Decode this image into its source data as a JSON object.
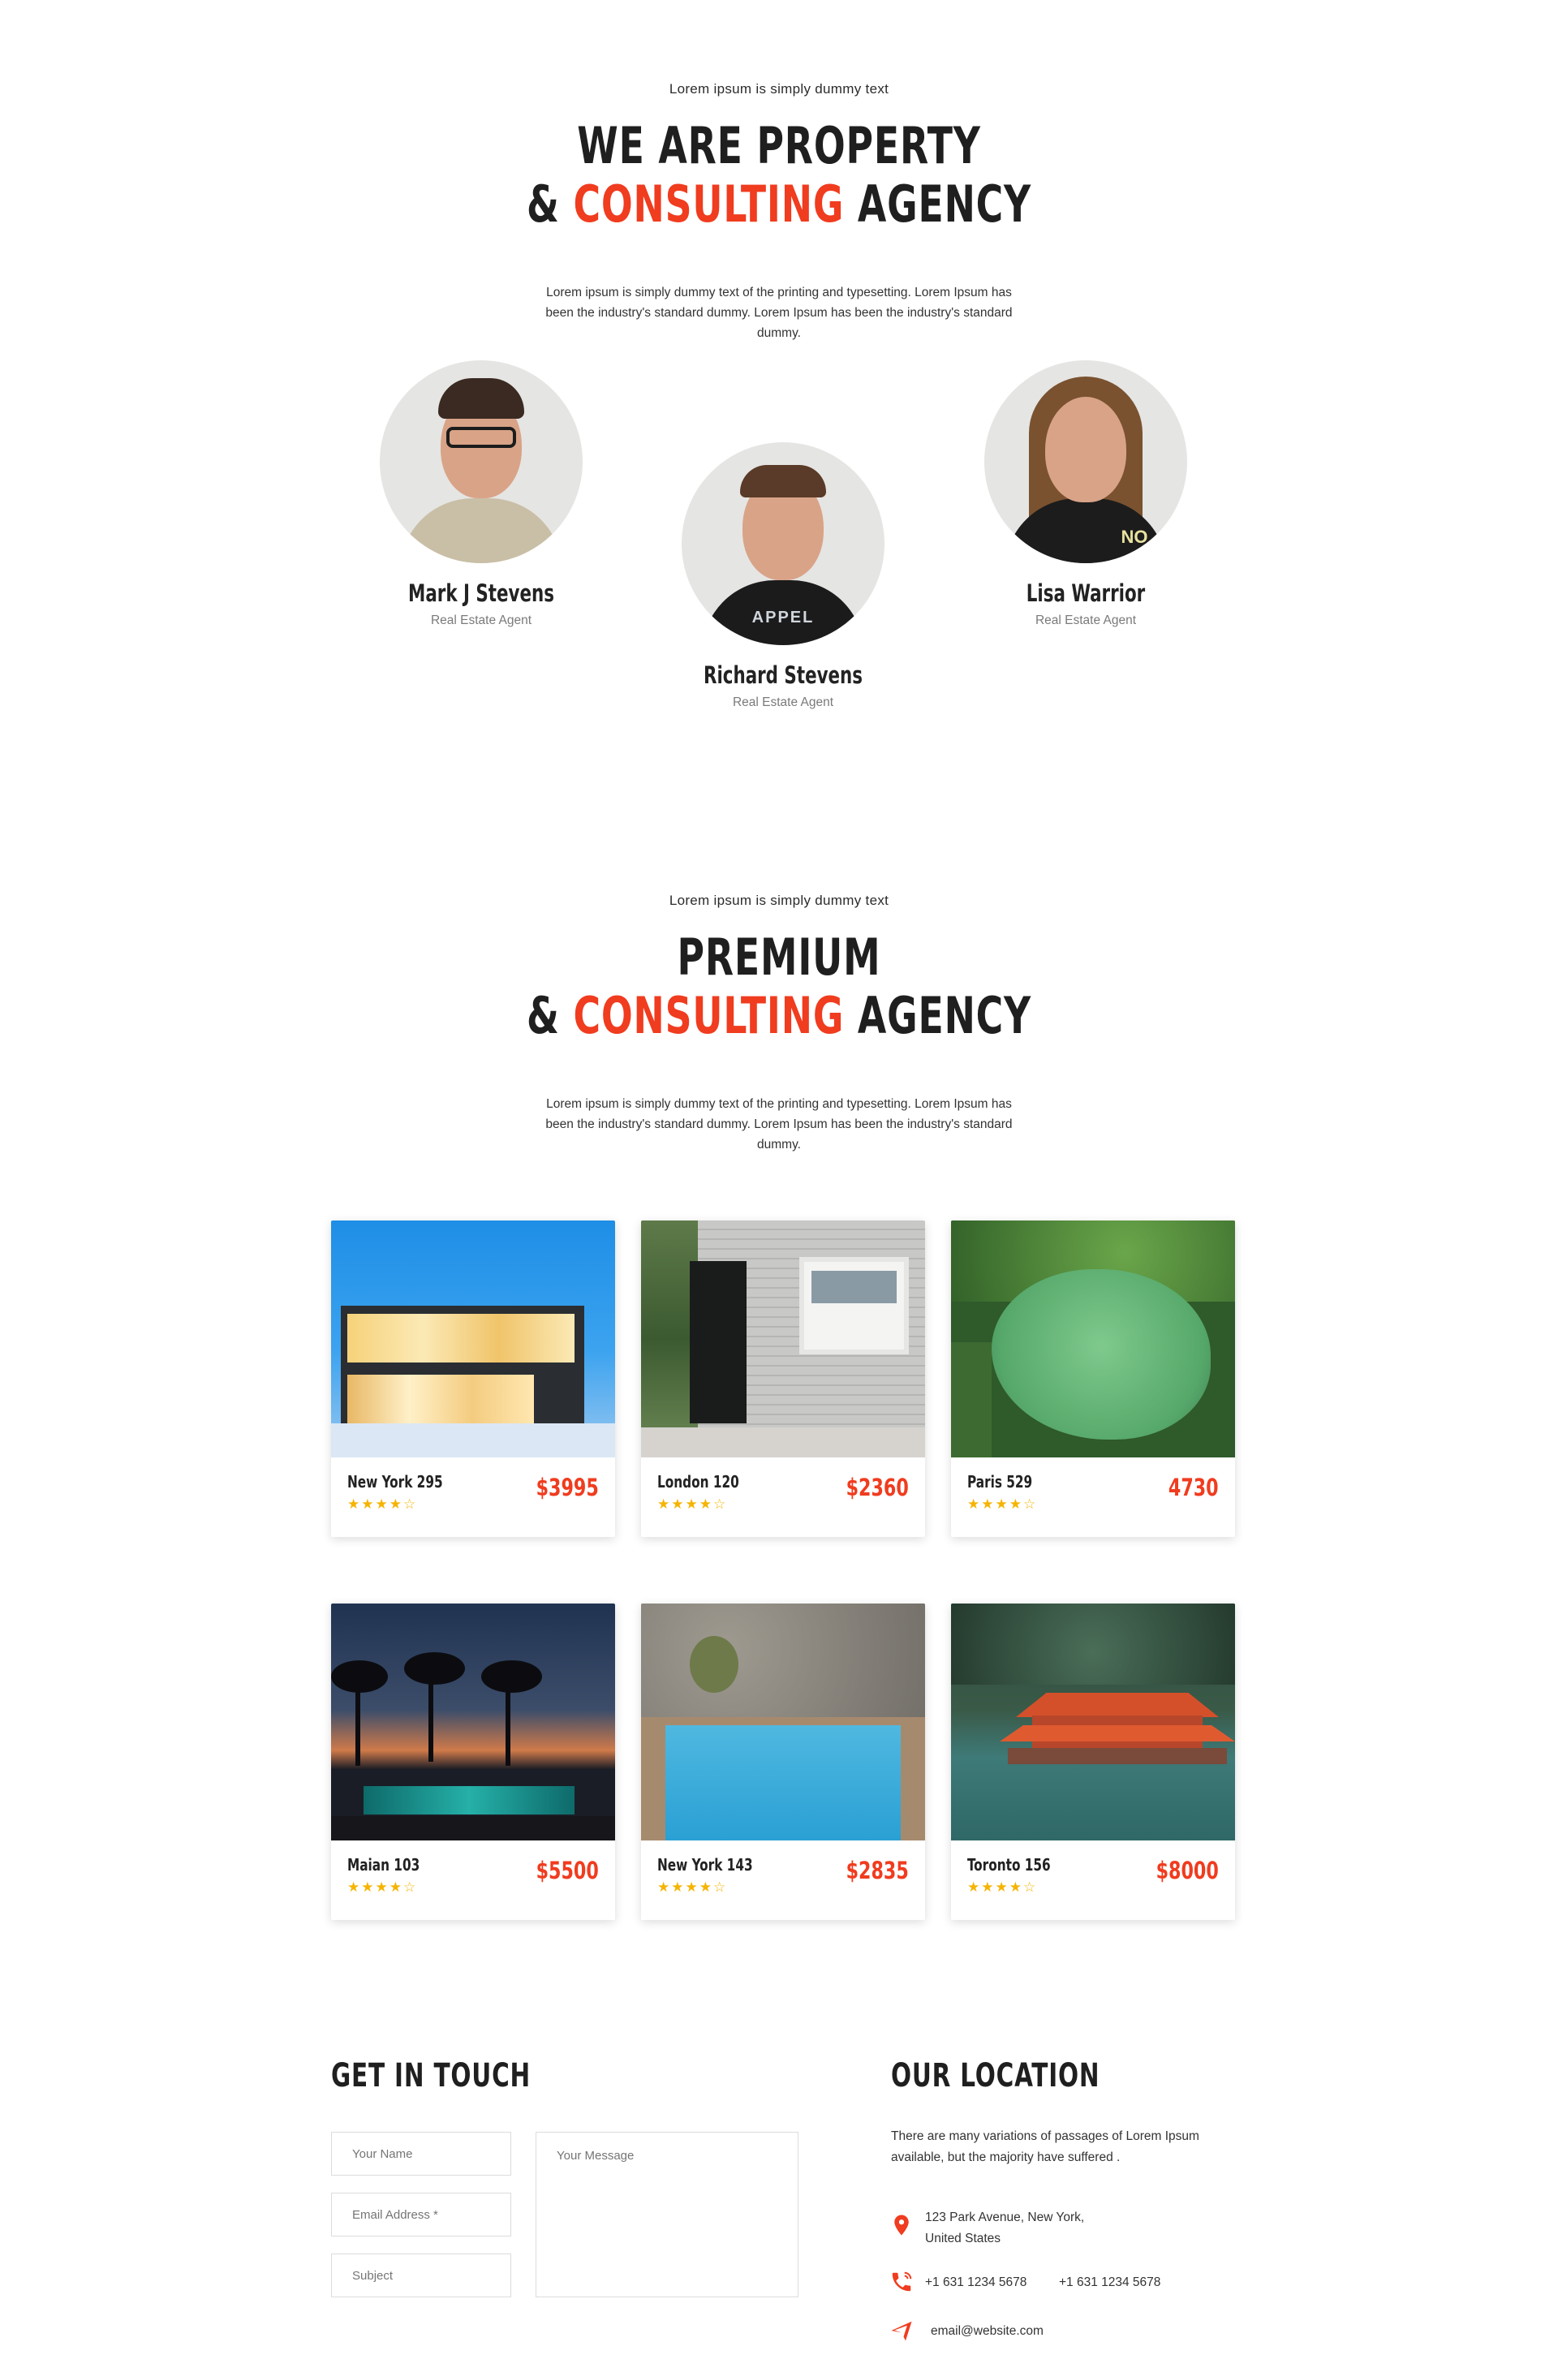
{
  "about": {
    "eyebrow": "Lorem ipsum is simply dummy text",
    "title_line1": "WE ARE PROPERTY",
    "title_amp": "&",
    "title_accent": "CONSULTING",
    "title_end": "AGENCY",
    "description": "Lorem ipsum is simply dummy text of the printing and typesetting. Lorem Ipsum has been the industry's standard dummy. Lorem Ipsum has been the industry's standard dummy."
  },
  "team": [
    {
      "name": "Mark J Stevens",
      "role": "Real Estate Agent"
    },
    {
      "name": "Richard Stevens",
      "role": "Real Estate Agent"
    },
    {
      "name": "Lisa Warrior",
      "role": "Real Estate Agent"
    }
  ],
  "premium": {
    "eyebrow": "Lorem ipsum is simply dummy text",
    "title_line1": "PREMIUM",
    "title_amp": "&",
    "title_accent": "CONSULTING",
    "title_end": "AGENCY",
    "description": "Lorem ipsum is simply dummy text of the printing and typesetting. Lorem Ipsum has been the industry's standard dummy. Lorem Ipsum has been the industry's standard dummy."
  },
  "properties": [
    {
      "name": "New York 295",
      "price": "$3995",
      "stars": "★★★★☆",
      "rating": 4
    },
    {
      "name": "London 120",
      "price": "$2360",
      "stars": "★★★★☆",
      "rating": 4
    },
    {
      "name": "Paris 529",
      "price": "4730",
      "stars": "★★★★☆",
      "rating": 4
    },
    {
      "name": "Maian 103",
      "price": "$5500",
      "stars": "★★★★☆",
      "rating": 4
    },
    {
      "name": "New York 143",
      "price": "$2835",
      "stars": "★★★★☆",
      "rating": 4
    },
    {
      "name": "Toronto 156",
      "price": "$8000",
      "stars": "★★★★☆",
      "rating": 4
    }
  ],
  "contact": {
    "title": "GET IN TOUCH",
    "name_placeholder": "Your Name",
    "email_placeholder": "Email Address *",
    "subject_placeholder": "Subject",
    "message_placeholder": "Your Message"
  },
  "location": {
    "title": "OUR LOCATION",
    "description": "There are many variations of passages of Lorem Ipsum available, but the majority have suffered .",
    "address_line1": "123 Park Avenue, New York,",
    "address_line2": "United States",
    "phone1": "+1 631 1234 5678",
    "phone2": "+1 631 1234 5678",
    "email": "email@website.com",
    "icons": [
      "map-pin-icon",
      "phone-icon",
      "paper-plane-icon"
    ]
  },
  "colors": {
    "accent": "#f03c1f",
    "star": "#f5b400",
    "text": "#222222"
  }
}
